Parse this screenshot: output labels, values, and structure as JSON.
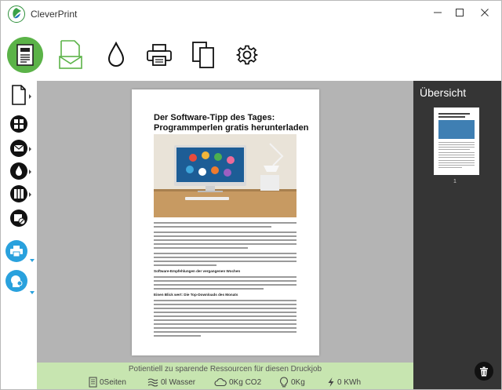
{
  "app": {
    "title": "CleverPrint"
  },
  "colors": {
    "accent_green": "#5bb348",
    "accent_blue": "#29a1dd",
    "savings_bar": "#c7e5b0",
    "overview_bg": "#353535",
    "preview_bg": "#b4b4b4"
  },
  "toolbar": {
    "items": [
      {
        "icon": "document-icon",
        "active": true
      },
      {
        "icon": "email-icon",
        "active": false
      },
      {
        "icon": "ink-drop-icon",
        "active": false
      },
      {
        "icon": "printer-icon",
        "active": false
      },
      {
        "icon": "copies-icon",
        "active": false
      },
      {
        "icon": "gear-icon",
        "active": false
      }
    ]
  },
  "sidebar": {
    "items": [
      {
        "icon": "page-icon"
      },
      {
        "icon": "grid-icon"
      },
      {
        "icon": "mail-icon"
      },
      {
        "icon": "drop-icon"
      },
      {
        "icon": "columns-icon"
      },
      {
        "icon": "no-image-icon"
      },
      {
        "icon": "printer-icon"
      },
      {
        "icon": "stamp-icon"
      }
    ]
  },
  "document": {
    "title": "Der Software-Tipp des Tages: Programmperlen gratis herunterladen",
    "subheading_1": "Software-Empfehlungen der vergangenen Wochen",
    "subheading_2": "Einen Blick wert: Die Top-Downloads des Monats"
  },
  "overview": {
    "title": "Übersicht",
    "page_number": "1"
  },
  "savings": {
    "title": "Potientiell zu sparende Ressourcen für diesen Druckjob",
    "pages": "0Seiten",
    "water": "0l Wasser",
    "co2": "0Kg CO2",
    "material": "0Kg",
    "energy": "0 KWh"
  }
}
